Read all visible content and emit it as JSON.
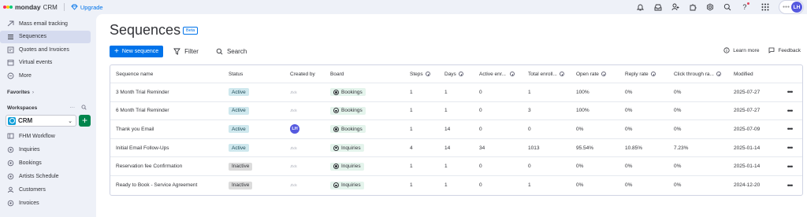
{
  "topbar": {
    "brand_name": "monday",
    "brand_sub": "CRM",
    "upgrade_label": "Upgrade",
    "avatar_initials": "LH",
    "colors": {
      "brand_green": "#00ca72",
      "brand_yellow": "#ffcb00",
      "brand_red": "#fb275d",
      "upgrade_blue": "#0073ea",
      "avatar_purple": "#5559df"
    },
    "icons": [
      "bell-icon",
      "inbox-icon",
      "invite-members-icon",
      "apps-icon",
      "integrations-icon",
      "search-icon",
      "help-icon",
      "app-grid-icon"
    ]
  },
  "sidebar": {
    "items": [
      {
        "label": "Mass email tracking",
        "icon": "email-tracking-icon",
        "active": false
      },
      {
        "label": "Sequences",
        "icon": "sequences-icon",
        "active": true
      },
      {
        "label": "Quotes and Invoices",
        "icon": "quotes-icon",
        "active": false
      },
      {
        "label": "Virtual events",
        "icon": "calendar-icon",
        "active": false
      },
      {
        "label": "More",
        "icon": "more-circle-icon",
        "active": false
      }
    ],
    "favorites_label": "Favorites",
    "workspaces_label": "Workspaces",
    "workspace_name": "CRM",
    "boards": [
      {
        "label": "FHM Workflow",
        "icon": "workflow-icon"
      },
      {
        "label": "Inquiries",
        "icon": "board-icon"
      },
      {
        "label": "Bookings",
        "icon": "board-icon"
      },
      {
        "label": "Artists Schedule",
        "icon": "board-icon"
      },
      {
        "label": "Customers",
        "icon": "contacts-icon"
      },
      {
        "label": "Invoices",
        "icon": "board-icon"
      }
    ]
  },
  "main": {
    "title": "Sequences",
    "beta_label": "Beta",
    "new_sequence_label": "New sequence",
    "filter_label": "Filter",
    "search_label": "Search",
    "learn_more_label": "Learn more",
    "feedback_label": "Feedback"
  },
  "table": {
    "columns": [
      "Sequence name",
      "Status",
      "Created by",
      "Board",
      "Steps",
      "Days",
      "Active enr...",
      "Total enroll...",
      "Open rate",
      "Reply rate",
      "Click through ra...",
      "Modified"
    ],
    "rows": [
      {
        "name": "3 Month Trial Reminder",
        "status": "Active",
        "status_kind": "active",
        "by": "blur",
        "board": "Bookings",
        "steps": "1",
        "days": "1",
        "active": "0",
        "total": "1",
        "open": "100%",
        "reply": "0%",
        "click": "0%",
        "modified": "2025-07-27"
      },
      {
        "name": "6 Month Trial Reminder",
        "status": "Active",
        "status_kind": "active",
        "by": "blur",
        "board": "Bookings",
        "steps": "1",
        "days": "1",
        "active": "0",
        "total": "3",
        "open": "100%",
        "reply": "0%",
        "click": "0%",
        "modified": "2025-07-27"
      },
      {
        "name": "Thank you Email",
        "status": "Active",
        "status_kind": "active",
        "by": "LH",
        "board": "Bookings",
        "steps": "1",
        "days": "14",
        "active": "0",
        "total": "0",
        "open": "0%",
        "reply": "0%",
        "click": "0%",
        "modified": "2025-07-09"
      },
      {
        "name": "Initial Email Follow-Ups",
        "status": "Active",
        "status_kind": "active",
        "by": "blur",
        "board": "Inquiries",
        "steps": "4",
        "days": "14",
        "active": "34",
        "total": "1013",
        "open": "95.54%",
        "reply": "10.85%",
        "click": "7.23%",
        "modified": "2025-01-14"
      },
      {
        "name": "Reservation fee Confirmation",
        "status": "Inactive",
        "status_kind": "inactive",
        "by": "blur",
        "board": "Inquiries",
        "steps": "1",
        "days": "1",
        "active": "0",
        "total": "0",
        "open": "0%",
        "reply": "0%",
        "click": "0%",
        "modified": "2025-01-14"
      },
      {
        "name": "Ready to Book - Service Agreement",
        "status": "Inactive",
        "status_kind": "inactive",
        "by": "blur",
        "board": "Inquiries",
        "steps": "1",
        "days": "1",
        "active": "0",
        "total": "1",
        "open": "0%",
        "reply": "0%",
        "click": "0%",
        "modified": "2024-12-20"
      }
    ]
  }
}
